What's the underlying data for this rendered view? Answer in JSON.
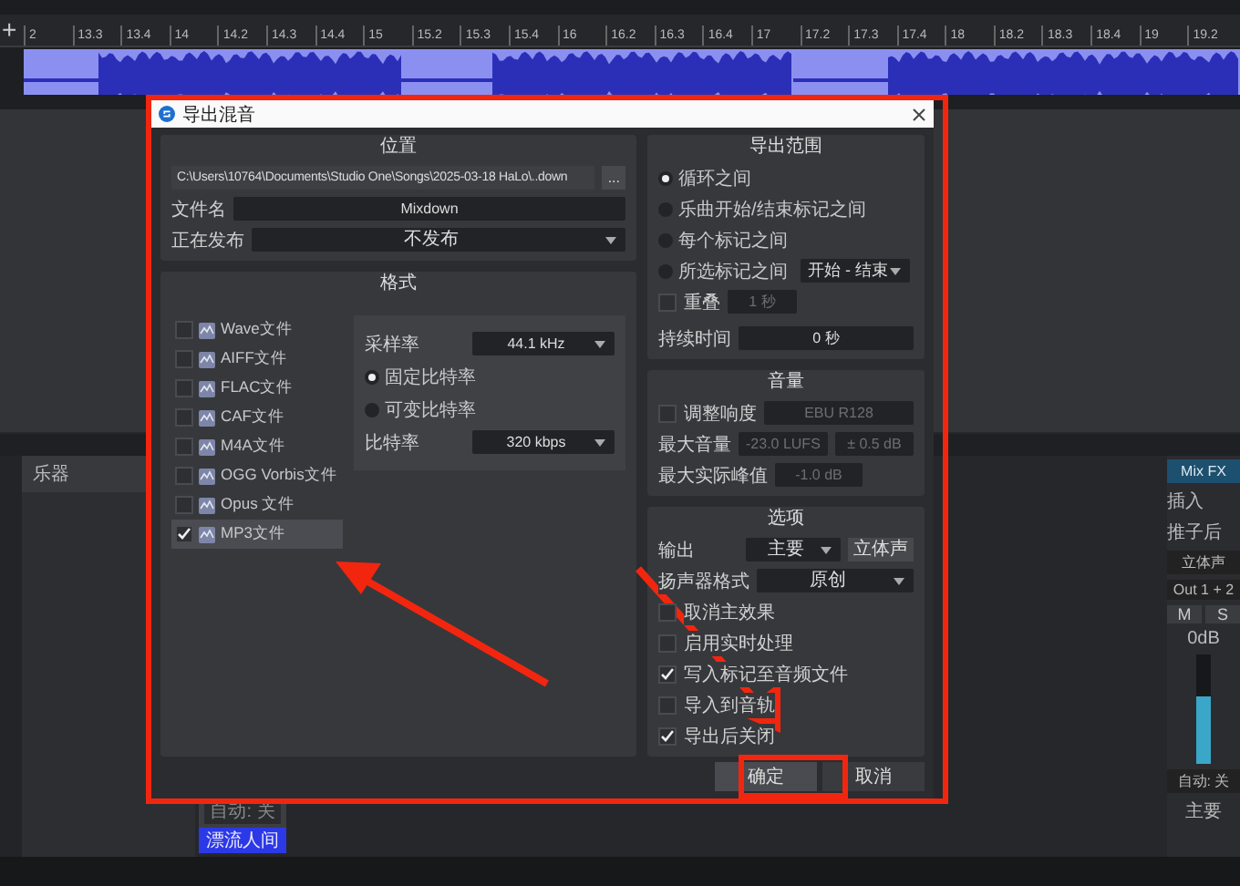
{
  "daw": {
    "add_button": "+",
    "ruler": [
      "2",
      "13.3",
      "13.4",
      "14",
      "14.2",
      "14.3",
      "14.4",
      "15",
      "15.2",
      "15.3",
      "15.4",
      "16",
      "16.2",
      "16.3",
      "16.4",
      "17",
      "17.2",
      "17.3",
      "17.4",
      "18",
      "18.2",
      "18.3",
      "18.4",
      "19",
      "19.2"
    ],
    "instruments_panel": {
      "title": "乐器"
    },
    "track_clip": {
      "automation": "自动: 关",
      "name": "漂流人间"
    },
    "mixer": {
      "mix_fx": "Mix FX",
      "insert": "插入",
      "post_fader": "推子后",
      "stereo": "立体声",
      "output": "Out 1 + 2",
      "mute": "M",
      "solo": "S",
      "volume": "0dB",
      "level": 0.62,
      "automation": "自动: 关",
      "channel": "主要"
    }
  },
  "dialog": {
    "title": "导出混音",
    "location": {
      "heading": "位置",
      "path": "C:\\Users\\10764\\Documents\\Studio One\\Songs\\2025-03-18 HaLo\\..down",
      "browse": "...",
      "filename_label": "文件名",
      "filename": "Mixdown",
      "publish_label": "正在发布",
      "publish": "不发布"
    },
    "format": {
      "heading": "格式",
      "types": [
        {
          "label": "Wave文件",
          "checked": false,
          "selected": false
        },
        {
          "label": "AIFF文件",
          "checked": false,
          "selected": false
        },
        {
          "label": "FLAC文件",
          "checked": false,
          "selected": false
        },
        {
          "label": "CAF文件",
          "checked": false,
          "selected": false
        },
        {
          "label": "M4A文件",
          "checked": false,
          "selected": false
        },
        {
          "label": "OGG Vorbis文件",
          "checked": false,
          "selected": false
        },
        {
          "label": "Opus 文件",
          "checked": false,
          "selected": false
        },
        {
          "label": "MP3文件",
          "checked": true,
          "selected": true
        }
      ],
      "settings": {
        "sample_rate_label": "采样率",
        "sample_rate": "44.1 kHz",
        "modes": [
          {
            "label": "固定比特率",
            "selected": true
          },
          {
            "label": "可变比特率",
            "selected": false
          }
        ],
        "bitrate_label": "比特率",
        "bitrate": "320 kbps"
      }
    },
    "range": {
      "heading": "导出范围",
      "options": [
        {
          "label": "循环之间",
          "selected": true
        },
        {
          "label": "乐曲开始/结束标记之间",
          "selected": false
        },
        {
          "label": "每个标记之间",
          "selected": false
        },
        {
          "label": "所选标记之间",
          "selected": false,
          "dropdown": "开始 - 结束"
        }
      ],
      "overlap": {
        "label": "重叠",
        "checked": false,
        "value": "1 秒"
      },
      "duration_label": "持续时间",
      "duration": "0 秒"
    },
    "volume": {
      "heading": "音量",
      "normalize": {
        "label": "调整响度",
        "checked": false,
        "value": "EBU R128"
      },
      "max_loudness_label": "最大音量",
      "max_loudness": "-23.0 LUFS",
      "tolerance": "± 0.5 dB",
      "max_peak_label": "最大实际峰值",
      "max_peak": "-1.0 dB"
    },
    "options": {
      "heading": "选项",
      "output_label": "输出",
      "output": "主要",
      "channel_button": "立体声",
      "speaker_label": "扬声器格式",
      "speaker": "原创",
      "checks": [
        {
          "label": "取消主效果",
          "checked": false
        },
        {
          "label": "启用实时处理",
          "checked": false
        },
        {
          "label": "写入标记至音频文件",
          "checked": true
        },
        {
          "label": "导入到音轨",
          "checked": false
        },
        {
          "label": "导出后关闭",
          "checked": true
        }
      ]
    },
    "buttons": [
      {
        "label": "确定",
        "kind": "primary"
      },
      {
        "label": "取消",
        "kind": "secondary"
      }
    ]
  }
}
